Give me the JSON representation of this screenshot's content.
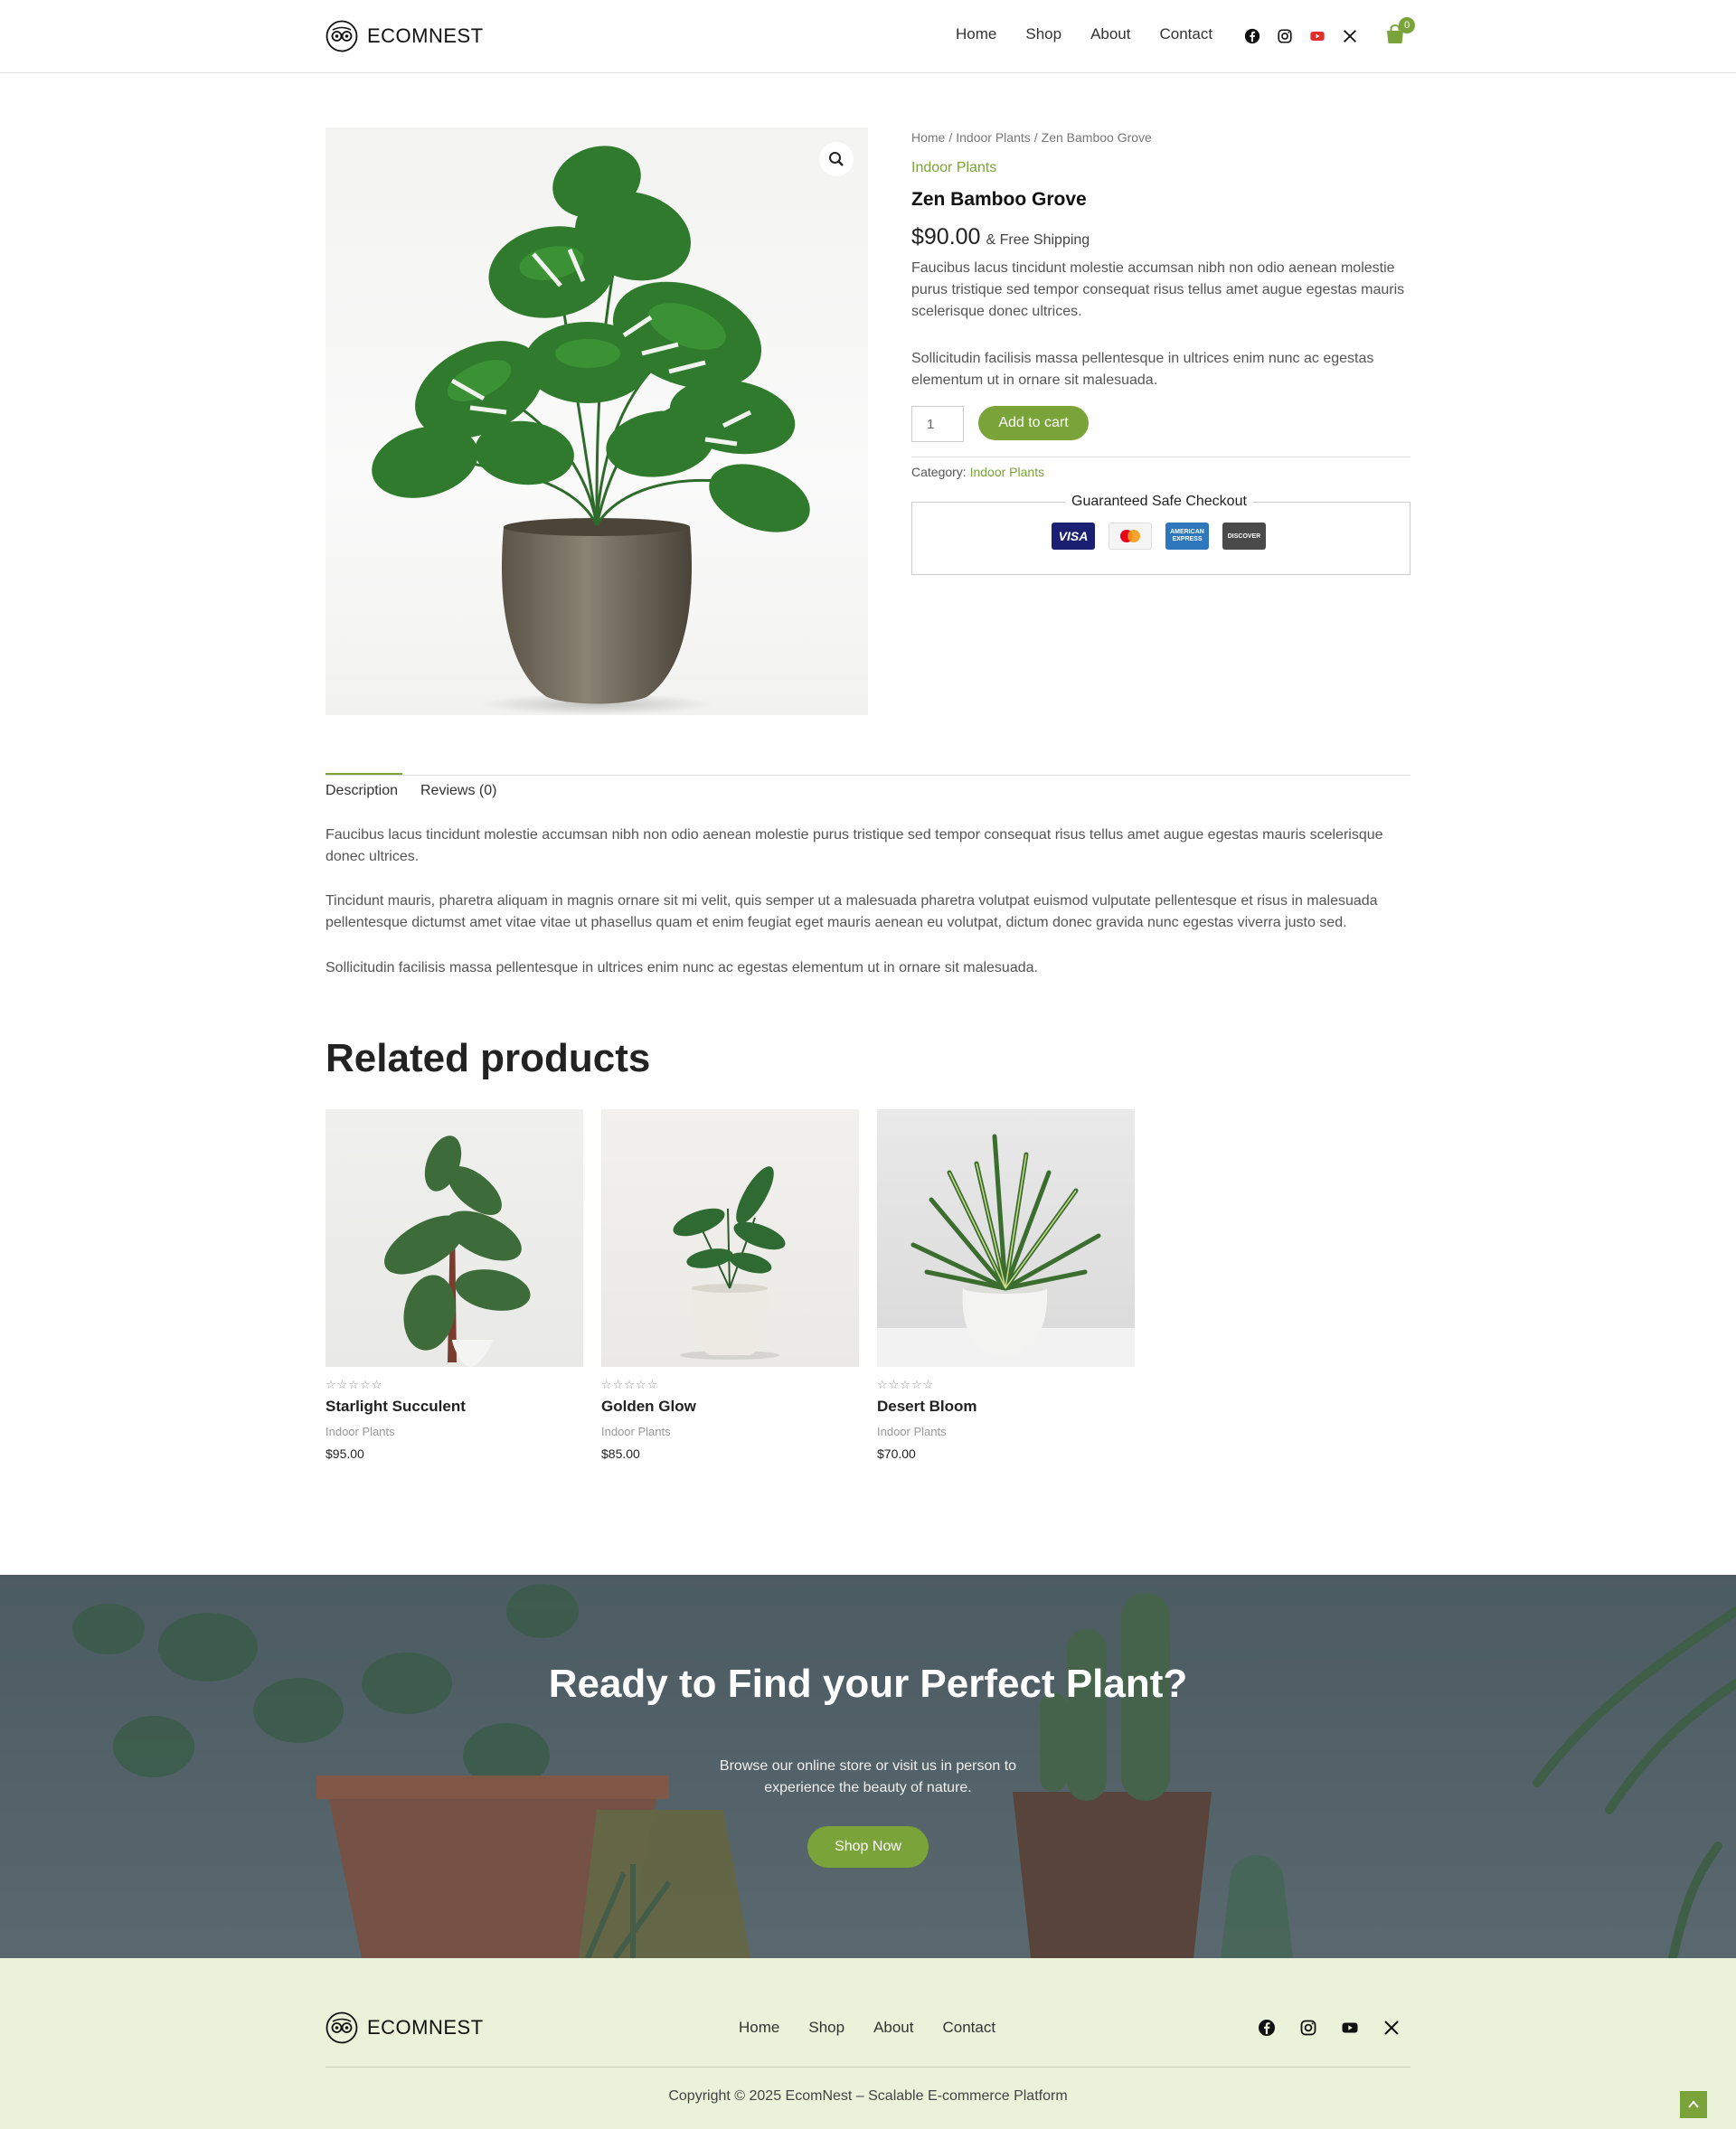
{
  "header": {
    "brand": "ECOMNEST",
    "nav": [
      "Home",
      "Shop",
      "About",
      "Contact"
    ],
    "social_icons": [
      "facebook-icon",
      "instagram-icon",
      "youtube-icon",
      "x-icon"
    ],
    "cart_count": "0"
  },
  "product": {
    "breadcrumb": [
      "Home",
      "Indoor Plants",
      "Zen Bamboo Grove"
    ],
    "category": "Indoor Plants",
    "title": "Zen Bamboo Grove",
    "price": "$90.00",
    "shipping": "& Free Shipping",
    "short_desc_1": "Faucibus lacus tincidunt molestie accumsan nibh non odio aenean molestie purus tristique sed tempor consequat risus tellus amet augue egestas mauris scelerisque donec ultrices.",
    "short_desc_2": "Sollicitudin facilisis massa pellentesque in ultrices enim nunc ac egestas elementum ut in ornare sit malesuada.",
    "qty_value": "1",
    "add_to_cart": "Add to cart",
    "category_label": "Category:",
    "category_link": "Indoor Plants",
    "checkout_label": "Guaranteed Safe Checkout",
    "cards": [
      "VISA",
      "mastercard",
      "AMERICAN EXPRESS",
      "DISCOVER"
    ]
  },
  "tabs": {
    "items": [
      "Description",
      "Reviews (0)"
    ],
    "active": "Description",
    "paragraphs": [
      "Faucibus lacus tincidunt molestie accumsan nibh non odio aenean molestie purus tristique sed tempor consequat risus tellus amet augue egestas mauris scelerisque donec ultrices.",
      "Tincidunt mauris, pharetra aliquam in magnis ornare sit mi velit, quis semper ut a malesuada pharetra volutpat euismod vulputate pellentesque et risus in malesuada pellentesque dictumst amet vitae vitae ut phasellus quam et enim feugiat eget mauris aenean eu volutpat, dictum donec gravida nunc egestas viverra justo sed.",
      "Sollicitudin facilisis massa pellentesque in ultrices enim nunc ac egestas elementum ut in ornare sit malesuada."
    ]
  },
  "related": {
    "heading": "Related products",
    "items": [
      {
        "name": "Starlight Succulent",
        "category": "Indoor Plants",
        "price": "$95.00",
        "stars": "☆☆☆☆☆"
      },
      {
        "name": "Golden Glow",
        "category": "Indoor Plants",
        "price": "$85.00",
        "stars": "☆☆☆☆☆"
      },
      {
        "name": "Desert Bloom",
        "category": "Indoor Plants",
        "price": "$70.00",
        "stars": "☆☆☆☆☆"
      }
    ]
  },
  "cta": {
    "title": "Ready to Find your Perfect Plant?",
    "subtitle": "Browse our online store or visit us in person to experience the beauty of nature.",
    "button": "Shop Now"
  },
  "footer": {
    "brand": "ECOMNEST",
    "nav": [
      "Home",
      "Shop",
      "About",
      "Contact"
    ],
    "copyright": "Copyright © 2025 EcomNest – Scalable E-commerce Platform"
  },
  "colors": {
    "accent": "#7aa33a",
    "footer_bg": "#eaf2da"
  }
}
